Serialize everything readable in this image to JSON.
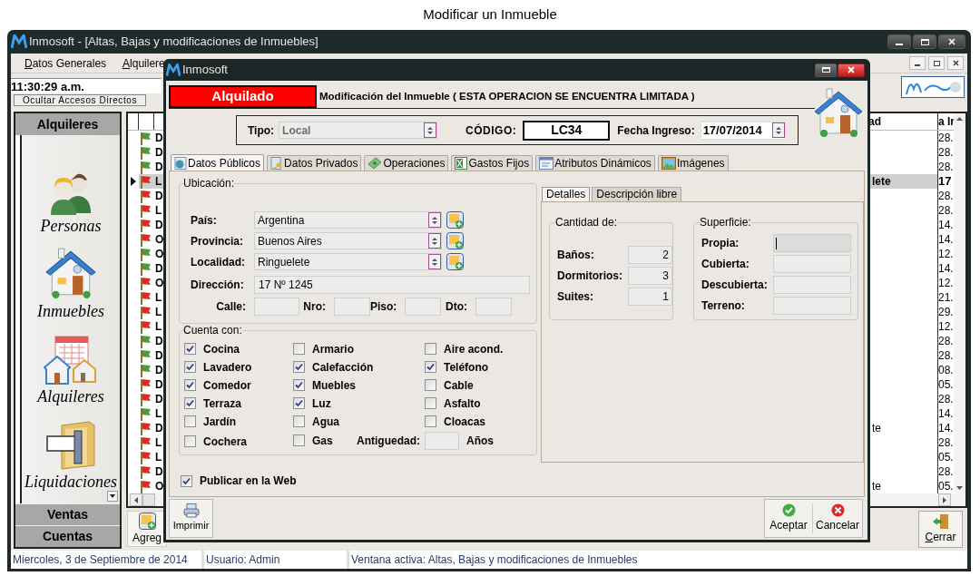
{
  "caption": "Modificar un Inmueble",
  "main_window": {
    "title": "Inmosoft - [Altas, Bajas y modificaciones de Inmuebles]"
  },
  "menu": [
    {
      "label": "Datos Generales"
    },
    {
      "label": "Alquilere"
    }
  ],
  "clock": "11:30:29 a.m.",
  "hide_shortcuts_button": "Ocultar Accesos Directos",
  "sidebar": {
    "header": "Alquileres",
    "items": [
      {
        "label": "Personas",
        "kind": "people"
      },
      {
        "label": "Inmuebles",
        "kind": "house"
      },
      {
        "label": "Alquileres",
        "kind": "calendar"
      },
      {
        "label": "Liquidaciones",
        "kind": "folder"
      }
    ],
    "sections": [
      "Ventas",
      "Cuentas"
    ]
  },
  "grid": {
    "column_headers": [
      "ad",
      "a Ir"
    ],
    "rows": [
      {
        "color": "#3f9e46",
        "column_1": "D",
        "column_3": "28.",
        "selected": false
      },
      {
        "color": "#3f9e46",
        "column_1": "D",
        "column_3": "28.",
        "selected": false
      },
      {
        "color": "#3f9e46",
        "column_1": "D",
        "column_3": "28.",
        "selected": false
      },
      {
        "color": "#e02828",
        "column_1": "L",
        "column_2": "lete",
        "column_3": "17",
        "selected": true
      },
      {
        "color": "#e02828",
        "column_1": "D",
        "column_3": "28.",
        "selected": false
      },
      {
        "color": "#e02828",
        "column_1": "L",
        "column_3": "28.",
        "selected": false
      },
      {
        "color": "#e02828",
        "column_1": "D",
        "column_3": "14.",
        "selected": false
      },
      {
        "color": "#e02828",
        "column_1": "O",
        "column_3": "14.",
        "selected": false
      },
      {
        "color": "#3f9e46",
        "column_1": "O",
        "column_3": "12.",
        "selected": false
      },
      {
        "color": "#3f9e46",
        "column_1": "D",
        "column_3": "14.",
        "selected": false
      },
      {
        "color": "#e02828",
        "column_1": "O",
        "column_3": "12.",
        "selected": false
      },
      {
        "color": "#e02828",
        "column_1": "L",
        "column_3": "21.",
        "selected": false
      },
      {
        "color": "#e02828",
        "column_1": "L",
        "column_3": "29.",
        "selected": false
      },
      {
        "color": "#e02828",
        "column_1": "L",
        "column_3": "12.",
        "selected": false
      },
      {
        "color": "#3f9e46",
        "column_1": "D",
        "column_3": "28.",
        "selected": false
      },
      {
        "color": "#3f9e46",
        "column_1": "D",
        "column_3": "28.",
        "selected": false
      },
      {
        "color": "#3f9e46",
        "column_1": "D",
        "column_3": "08.",
        "selected": false
      },
      {
        "color": "#e02828",
        "column_1": "D",
        "column_3": "05.",
        "selected": false
      },
      {
        "color": "#e02828",
        "column_1": "D",
        "column_3": "28.",
        "selected": false
      },
      {
        "color": "#3f9e46",
        "column_1": "L",
        "column_3": "14.",
        "selected": false
      },
      {
        "color": "#e02828",
        "column_1": "D",
        "column_2": "te",
        "column_3": "14.",
        "selected": false
      },
      {
        "color": "#e02828",
        "column_1": "L",
        "column_3": "28.",
        "selected": false
      },
      {
        "color": "#e02828",
        "column_1": "L",
        "column_3": "05.",
        "selected": false
      },
      {
        "color": "#e02828",
        "column_1": "D",
        "column_3": "28.",
        "selected": false
      },
      {
        "color": "#e02828",
        "column_1": "O",
        "column_2": "te",
        "column_3": "05.",
        "selected": false
      }
    ]
  },
  "add_button": "Agreg",
  "close_button": "Cerrar",
  "status_bar": [
    "Miercoles, 3 de Septiembre de 2014",
    "Usuario: Admin",
    "Ventana activa: Altas, Bajas y modificaciones de Inmuebles"
  ],
  "dialog": {
    "title": "Inmosoft",
    "status": "Alquilado",
    "heading": "Modificación del Inmueble ( ESTA OPERACION SE ENCUENTRA LIMITADA )",
    "tipo": {
      "label": "Tipo:",
      "value": "Local",
      "disabled": true
    },
    "codigo": {
      "label": "CÓDIGO:",
      "value": "LC34"
    },
    "fecha": {
      "label": "Fecha Ingreso:",
      "value": "17/07/2014"
    },
    "tabs": [
      {
        "label": "Datos Públicos",
        "selected": true,
        "kind": "globe"
      },
      {
        "label": "Datos Privados",
        "selected": false,
        "kind": "key"
      },
      {
        "label": "Operaciones",
        "selected": false,
        "kind": "money"
      },
      {
        "label": "Gastos Fijos",
        "selected": false,
        "kind": "sheet"
      },
      {
        "label": "Atributos Dinámicos",
        "selected": false,
        "kind": "form"
      },
      {
        "label": "Imágenes",
        "selected": false,
        "kind": "image"
      }
    ],
    "ubicacion": {
      "title": "Ubicación:",
      "combos": [
        {
          "label": "País:",
          "value": "Argentina"
        },
        {
          "label": "Provincia:",
          "value": "Buenos Aires"
        },
        {
          "label": "Localidad:",
          "value": "Ringuelete"
        }
      ],
      "direccion": {
        "label": "Dirección:",
        "value": "17 Nº 1245"
      },
      "parts": [
        {
          "label": "Calle:"
        },
        {
          "label": "Nro:"
        },
        {
          "label": "Piso:"
        },
        {
          "label": "Dto:"
        }
      ]
    },
    "cuenta_con": {
      "title": "Cuenta con:",
      "items": [
        {
          "label": "Cocina",
          "checked": true
        },
        {
          "label": "Armario",
          "checked": false
        },
        {
          "label": "Aire acond.",
          "checked": false
        },
        {
          "label": "Lavadero",
          "checked": true
        },
        {
          "label": "Calefacción",
          "checked": true
        },
        {
          "label": "Teléfono",
          "checked": true
        },
        {
          "label": "Comedor",
          "checked": true
        },
        {
          "label": "Muebles",
          "checked": true
        },
        {
          "label": "Cable",
          "checked": false
        },
        {
          "label": "Terraza",
          "checked": true
        },
        {
          "label": "Luz",
          "checked": true
        },
        {
          "label": "Asfalto",
          "checked": false
        },
        {
          "label": "Jardín",
          "checked": false
        },
        {
          "label": "Agua",
          "checked": false
        },
        {
          "label": "Cloacas",
          "checked": false
        },
        {
          "label": "Cochera",
          "checked": false
        },
        {
          "label": "Gas",
          "checked": false
        }
      ],
      "antiguedad": {
        "label": "Antiguedad:",
        "unit": "Años"
      }
    },
    "publicar": {
      "label": "Publicar en la Web",
      "checked": true
    },
    "subtabs": [
      {
        "label": "Detalles",
        "selected": true
      },
      {
        "label": "Descripción libre",
        "selected": false
      }
    ],
    "cantidad": {
      "title": "Cantidad de:",
      "fields": [
        {
          "label": "Baños:",
          "value": "2"
        },
        {
          "label": "Dormitorios:",
          "value": "3"
        },
        {
          "label": "Suites:",
          "value": "1"
        }
      ]
    },
    "superficie": {
      "title": "Superficie:",
      "fields": [
        {
          "label": "Propia:",
          "focused": true
        },
        {
          "label": "Cubierta:",
          "focused": false
        },
        {
          "label": "Descubierta:",
          "focused": false
        },
        {
          "label": "Terreno:",
          "focused": false
        }
      ]
    },
    "buttons": {
      "print": "Imprimir",
      "accept": "Aceptar",
      "cancel": "Cancelar"
    }
  }
}
